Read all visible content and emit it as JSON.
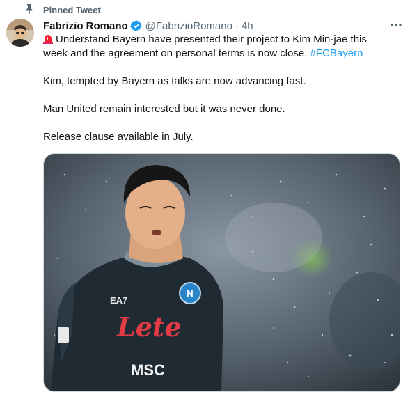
{
  "pinned": {
    "label": "Pinned Tweet",
    "icon": "pin-icon"
  },
  "author": {
    "name": "Fabrizio Romano",
    "handle": "@FabrizioRomano",
    "separator": "·",
    "time": "4h",
    "verified_icon": "verified-badge-icon"
  },
  "tweet": {
    "line1_emoji_icon": "siren-icon",
    "line1_text": "Understand Bayern have presented their project to Kim Min-jae this week and the agreement on personal terms is now close.",
    "hashtag": "#FCBayern",
    "line2": "Kim, tempted by Bayern as talks are now advancing fast.",
    "line3": "Man United remain interested but it was never done.",
    "line4": "Release clause available in July."
  },
  "media": {
    "description_icon": "photo-football-player",
    "shirt_texts": {
      "sponsor": "Lete",
      "brand": "EA7",
      "sponsor2": "MSC"
    }
  },
  "colors": {
    "accent": "#1d9bf0",
    "muted": "#536471",
    "text": "#0f1419"
  }
}
